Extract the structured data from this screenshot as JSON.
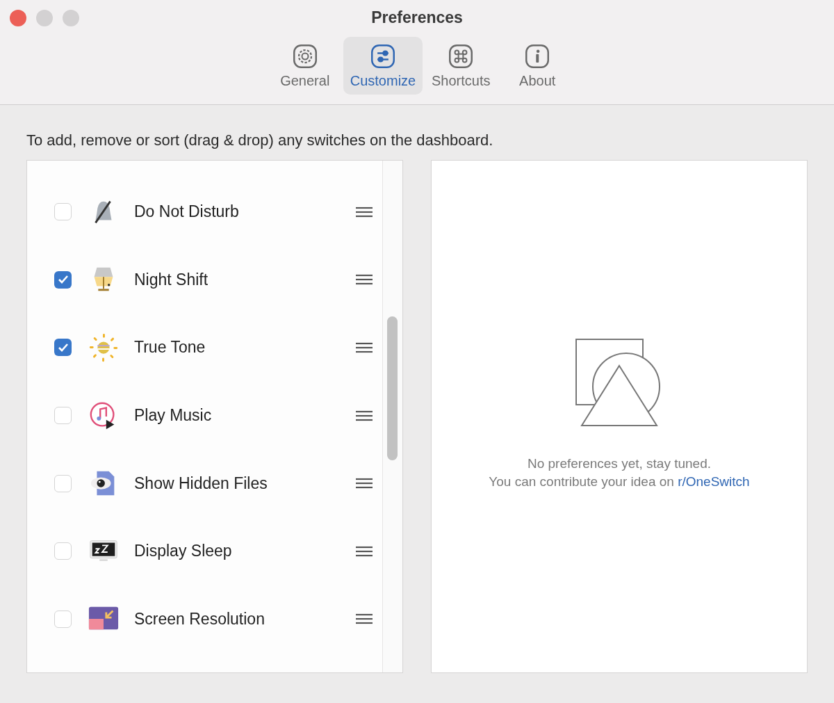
{
  "window": {
    "title": "Preferences",
    "controls": [
      {
        "kind": "close"
      },
      {
        "kind": "minimize"
      },
      {
        "kind": "zoom"
      }
    ]
  },
  "tabs": [
    {
      "label": "General",
      "kind": "gear",
      "selected": false
    },
    {
      "label": "Customize",
      "kind": "sliders",
      "selected": true
    },
    {
      "label": "Shortcuts",
      "kind": "command",
      "selected": false
    },
    {
      "label": "About",
      "kind": "info",
      "selected": false
    }
  ],
  "instructions": "To add, remove or sort (drag & drop) any switches on the dashboard.",
  "switches": [
    {
      "name": "Do Not Disturb",
      "kind": "bell",
      "checked": false
    },
    {
      "name": "Night Shift",
      "kind": "lamp",
      "checked": true
    },
    {
      "name": "True Tone",
      "kind": "sun",
      "checked": true
    },
    {
      "name": "Play Music",
      "kind": "music",
      "checked": false
    },
    {
      "name": "Show Hidden Files",
      "kind": "eye",
      "checked": false
    },
    {
      "name": "Display Sleep",
      "kind": "monitor",
      "checked": false
    },
    {
      "name": "Screen Resolution",
      "kind": "resolution",
      "checked": false
    }
  ],
  "detail": {
    "message": "No preferences yet, stay tuned.",
    "contribute_text": "You can contribute your idea on",
    "link": "r/OneSwitch"
  }
}
